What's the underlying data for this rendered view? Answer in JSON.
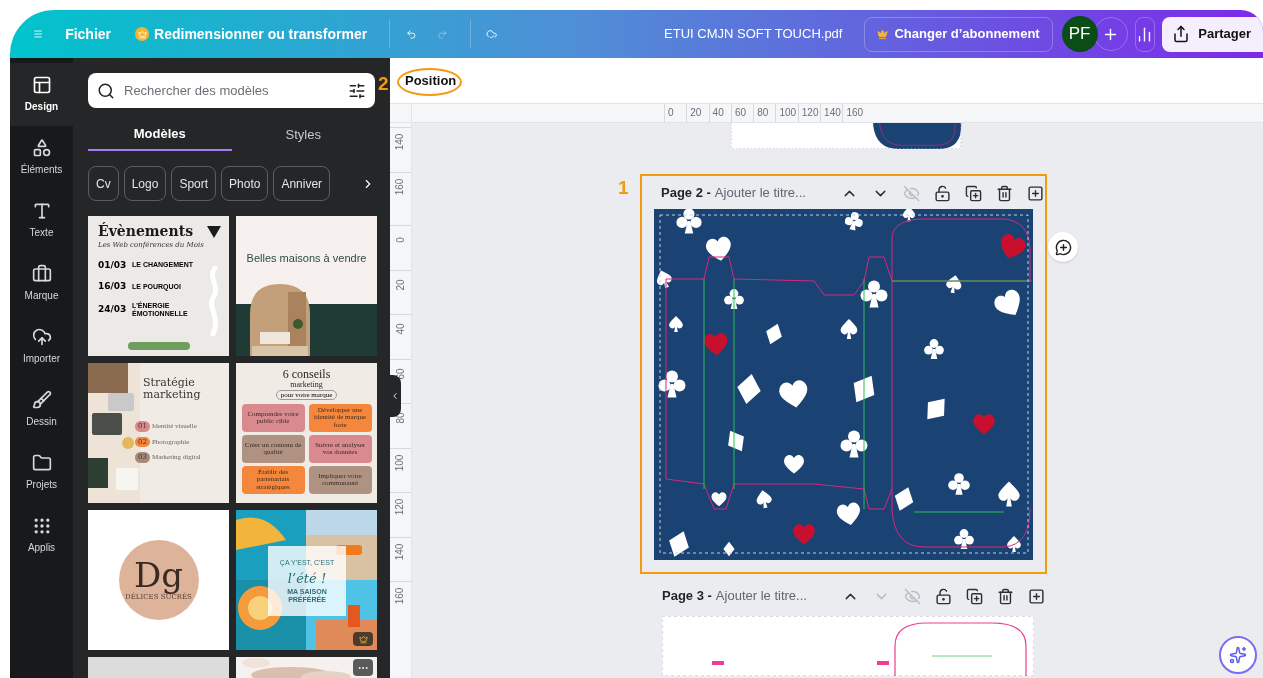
{
  "top_bar": {
    "file_menu": "Fichier",
    "resize_button": "Redimensionner ou transformer",
    "redo_disabled": true,
    "document_title": "ETUI CMJN SOFT TOUCH.pdf",
    "upgrade_button": "Changer d’abonnement",
    "avatar": "PF",
    "share_button": "Partager"
  },
  "sidebar": {
    "items": [
      {
        "label": "Design",
        "selected": true
      },
      {
        "label": "Éléments",
        "selected": false
      },
      {
        "label": "Texte",
        "selected": false
      },
      {
        "label": "Marque",
        "selected": false
      },
      {
        "label": "Importer",
        "selected": false
      },
      {
        "label": "Dessin",
        "selected": false
      },
      {
        "label": "Projets",
        "selected": false
      },
      {
        "label": "Applis",
        "selected": false
      }
    ]
  },
  "templates_panel": {
    "search": {
      "placeholder": "Rechercher des modèles"
    },
    "tabs": [
      {
        "label": "Modèles",
        "selected": true
      },
      {
        "label": "Styles",
        "selected": false
      }
    ],
    "chips": [
      "Cv",
      "Logo",
      "Sport",
      "Photo",
      "Anniver"
    ],
    "templates": [
      {
        "kind": "events",
        "title": "Évènements",
        "subtitle": "Les Web conférences du Mois",
        "entries": [
          {
            "date": "01/03",
            "heading": "LE CHANGEMENT"
          },
          {
            "date": "16/03",
            "heading": "LE POURQUOI"
          },
          {
            "date": "24/03",
            "heading": "L’ÉNERGIE ÉMOTIONNELLE"
          }
        ]
      },
      {
        "kind": "houses",
        "title": "Belles maisons à vendre"
      },
      {
        "kind": "strategy",
        "title": "Stratégie marketing",
        "steps": [
          {
            "number": "01",
            "label": "Identité visuelle",
            "color": "#d98a8f"
          },
          {
            "number": "02",
            "label": "Photographie",
            "color": "#f5873d"
          },
          {
            "number": "03",
            "label": "Marketing digital",
            "color": "#a68b7c"
          }
        ]
      },
      {
        "kind": "tips",
        "title": "6 conseils",
        "subtitle": "marketing",
        "tag": "pour votre marque",
        "tips": [
          {
            "label": "Comprendre votre public cible",
            "color": "#d98a8f"
          },
          {
            "label": "Développer une identité de marque forte",
            "color": "#f5873d"
          },
          {
            "label": "Créer un contenu de qualité",
            "color": "#b09282"
          },
          {
            "label": "Suivre et analyser vos données",
            "color": "#d98a8f"
          },
          {
            "label": "Établir des partenariats stratégiques",
            "color": "#f5873d"
          },
          {
            "label": "Impliquer votre communauté",
            "color": "#b09282"
          }
        ]
      },
      {
        "kind": "logo",
        "monogram": "Dg",
        "name": "DÉLICES SUCRÉS"
      },
      {
        "kind": "summer",
        "top": "ÇA Y’EST, C’EST",
        "headline": "l’été !",
        "bottom": "MA SAISON PRÉFÉRÉE",
        "premium": true
      },
      {
        "kind": "blank"
      },
      {
        "kind": "picture",
        "more_button": true
      }
    ]
  },
  "toolbar": {
    "position_button": "Position"
  },
  "rulers": {
    "horizontal": [
      "0",
      "20",
      "40",
      "60",
      "80",
      "100",
      "120",
      "140",
      "160"
    ],
    "vertical": [
      [
        "140",
        "160"
      ],
      [
        "0",
        "20",
        "40",
        "60",
        "80",
        "100",
        "120",
        "140",
        "160"
      ]
    ]
  },
  "pages": [
    {
      "label": "Page 2 -",
      "title": "Ajouter le titre...",
      "move_down_disabled": false,
      "highlighted": true
    },
    {
      "label": "Page 3 -",
      "title": "Ajouter le titre...",
      "move_down_disabled": true,
      "highlighted": false
    }
  ],
  "annotations": [
    "1",
    "2"
  ]
}
